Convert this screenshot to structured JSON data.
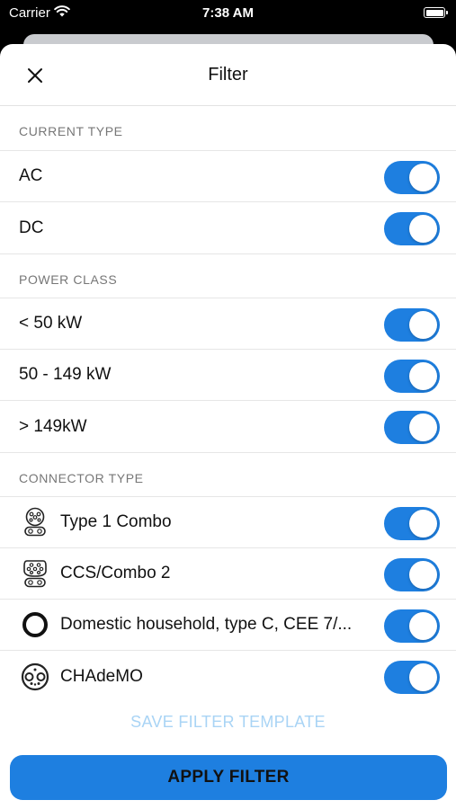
{
  "status_bar": {
    "carrier": "Carrier",
    "time": "7:38 AM",
    "wifi_icon": "wifi-icon",
    "battery_icon": "battery-icon"
  },
  "header": {
    "title": "Filter",
    "close_icon": "close-icon"
  },
  "sections": {
    "current_type": {
      "title": "CURRENT TYPE",
      "items": [
        {
          "label": "AC",
          "enabled": true
        },
        {
          "label": "DC",
          "enabled": true
        }
      ]
    },
    "power_class": {
      "title": "POWER CLASS",
      "items": [
        {
          "label": "< 50 kW",
          "enabled": true
        },
        {
          "label": "50 - 149 kW",
          "enabled": true
        },
        {
          "label": "> 149kW",
          "enabled": true
        }
      ]
    },
    "connector_type": {
      "title": "CONNECTOR TYPE",
      "items": [
        {
          "label": "Type 1 Combo",
          "icon": "type1-combo-connector-icon",
          "enabled": true
        },
        {
          "label": "CCS/Combo 2",
          "icon": "ccs-combo2-connector-icon",
          "enabled": true
        },
        {
          "label": "Domestic household, type C, CEE 7/...",
          "icon": "domestic-socket-icon",
          "enabled": true
        },
        {
          "label": "CHAdeMO",
          "icon": "chademo-connector-icon",
          "enabled": true
        }
      ]
    }
  },
  "actions": {
    "save_template": "SAVE FILTER TEMPLATE",
    "apply": "APPLY FILTER"
  },
  "colors": {
    "accent": "#1e7fe0",
    "save_template_text": "#a9d4f5",
    "section_header_text": "#777777"
  }
}
